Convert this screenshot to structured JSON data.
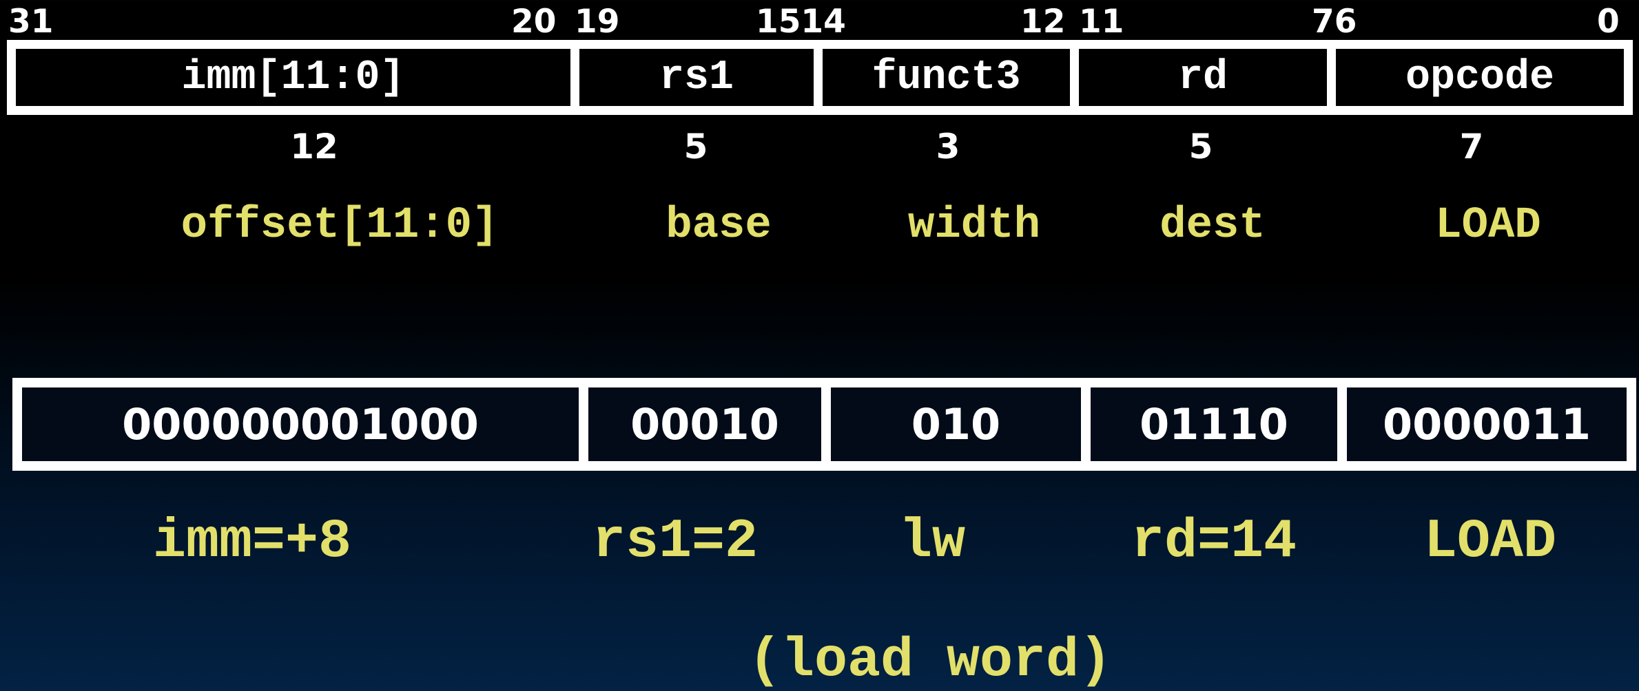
{
  "bit_positions": {
    "b31": "31",
    "b20": "20",
    "b19": "19",
    "b15_14": "1514",
    "b12": "12",
    "b11": "11",
    "b7_6": "76",
    "b0": "0"
  },
  "fields": [
    {
      "name": "imm[11:0]",
      "width": "12",
      "meaning": "offset[11:0]",
      "bits": "000000001000",
      "decoded": "imm=+8"
    },
    {
      "name": "rs1",
      "width": "5",
      "meaning": "base",
      "bits": "00010",
      "decoded": "rs1=2"
    },
    {
      "name": "funct3",
      "width": "3",
      "meaning": "width",
      "bits": "010",
      "decoded": "lw"
    },
    {
      "name": "rd",
      "width": "5",
      "meaning": "dest",
      "bits": "01110",
      "decoded": "rd=14"
    },
    {
      "name": "opcode",
      "width": "7",
      "meaning": "LOAD",
      "bits": "0000011",
      "decoded": "LOAD"
    }
  ],
  "note": "(load word)",
  "colors": {
    "text_white": "#ffffff",
    "text_yellow": "#e2e06a",
    "background_top": "#000000",
    "background_bottom": "#032244"
  }
}
